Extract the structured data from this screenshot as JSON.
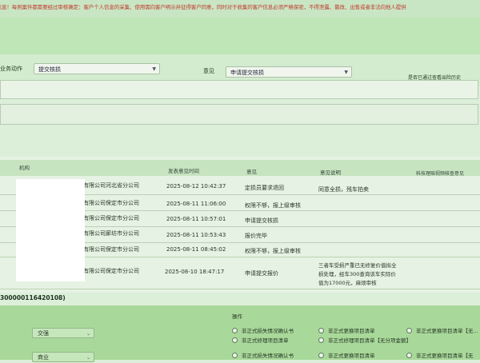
{
  "notice": {
    "text": "认真核对信息！每例案件都需要经过审核确定：客户个人信息的采集、使用需向客户明示并征得客户同意，同时对于收集的客户信息必须严格保密，不得泄露、篡改、出售或者非法向他人提供"
  },
  "form": {
    "action_label": "业务动作",
    "action_value": "提交核损",
    "opinion_label": "意见",
    "opinion_value": "申请提交核损",
    "right_hint": "是否已通过查看出险历史"
  },
  "table": {
    "headers": {
      "org": "机构",
      "time": "发表意见时间",
      "opinion": "意见",
      "explain": "意见说明",
      "ext": "科技理赔视频核查意见"
    },
    "rows": [
      {
        "org": "有限公司河北省分公司",
        "time": "2025-08-12 10:42:37",
        "opinion": "定损员要求退回",
        "explain": "同意全损，残车拍卖"
      },
      {
        "org": "有限公司保定市分公司",
        "time": "2025-08-11 11:06:00",
        "opinion": "权限不够，报上级审核",
        "explain": ""
      },
      {
        "org": "有限公司保定市分公司",
        "time": "2025-08-11 10:57:01",
        "opinion": "申请提交核损",
        "explain": ""
      },
      {
        "org": "有限公司廊坊市分公司",
        "time": "2025-08-11 10:53:43",
        "opinion": "报价完毕",
        "explain": ""
      },
      {
        "org": "有限公司保定市分公司",
        "time": "2025-08-11 08:45:02",
        "opinion": "权限不够，报上级审核",
        "explain": ""
      },
      {
        "org": "有限公司保定市分公司",
        "time": "2025-08-10 18:47:17",
        "opinion": "申请提交报价",
        "explain_lines": [
          "三者车受损严重已无修复价值拟全",
          "损处理，经车300查询该车实际价",
          "值为17000元，麻烦审核"
        ]
      }
    ]
  },
  "policy_no": "300000116420108)",
  "bottom": {
    "ops_label": "操作",
    "rows": [
      {
        "select": "交强",
        "opt1": "非正式损失情况确认书",
        "opt2": "非正式修理项目清单",
        "opt3": "非正式更换项目清单",
        "opt4": "非正式修理项目清单【无分项金额】",
        "opt5": "非正式更换项目清单【无..."
      },
      {
        "select": "商业",
        "opt1": "非正式损失情况确认书",
        "opt3": "非正式更换项目清单",
        "opt5": "非正式更换项目清单【无"
      }
    ]
  }
}
